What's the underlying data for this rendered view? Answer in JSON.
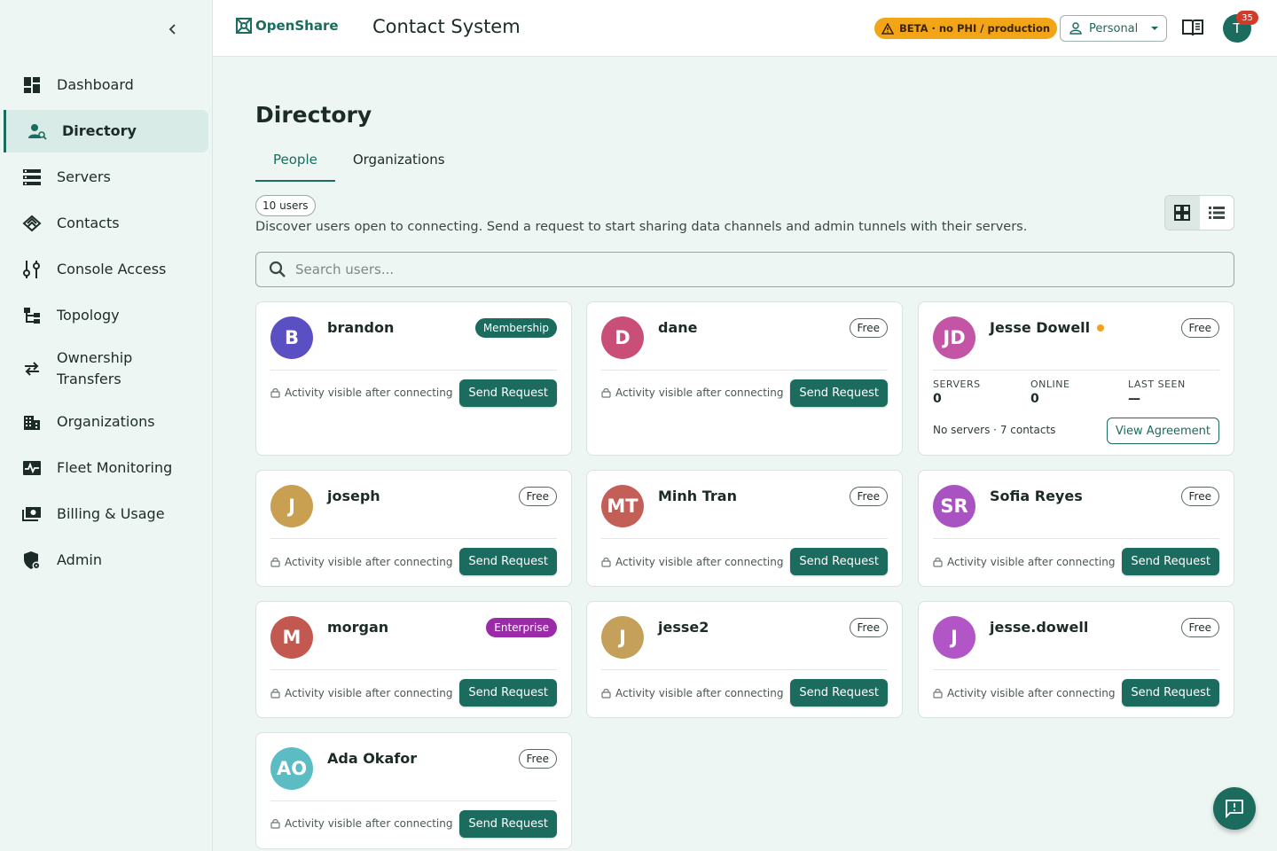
{
  "app": {
    "brand_name": "OpenShare",
    "title": "Contact System",
    "beta_label": "BETA · no PHI / production",
    "account_selector": "Personal",
    "notification_count": "35",
    "user_initial": "T"
  },
  "sidebar": {
    "items": [
      {
        "label": "Dashboard",
        "icon": "dashboard-icon"
      },
      {
        "label": "Directory",
        "icon": "directory-icon",
        "active": true
      },
      {
        "label": "Servers",
        "icon": "servers-icon"
      },
      {
        "label": "Contacts",
        "icon": "contacts-icon"
      },
      {
        "label": "Console Access",
        "icon": "console-access-icon"
      },
      {
        "label": "Topology",
        "icon": "topology-icon"
      },
      {
        "label": "Ownership Transfers",
        "icon": "transfer-icon"
      },
      {
        "label": "Organizations",
        "icon": "organizations-icon"
      },
      {
        "label": "Fleet Monitoring",
        "icon": "fleet-monitoring-icon"
      },
      {
        "label": "Billing & Usage",
        "icon": "billing-icon"
      },
      {
        "label": "Admin",
        "icon": "admin-icon"
      }
    ]
  },
  "main": {
    "title": "Directory",
    "tabs": [
      {
        "label": "People",
        "active": true
      },
      {
        "label": "Organizations",
        "active": false
      }
    ],
    "user_count": "10 users",
    "description": "Discover users open to connecting. Send a request to start sharing data channels and admin tunnels with their servers.",
    "search_placeholder": "Search users...",
    "view_mode": "grid"
  },
  "cards": [
    {
      "initials": "B",
      "name": "brandon",
      "plan": "Membership",
      "avatar_color": "#5b4fc4",
      "hint": "Activity visible after connecting",
      "action": "Send Request"
    },
    {
      "initials": "D",
      "name": "dane",
      "plan": "Free",
      "avatar_color": "#c94f78",
      "hint": "Activity visible after connecting",
      "action": "Send Request"
    },
    {
      "initials": "JD",
      "name": "Jesse Dowell",
      "plan": "Free",
      "avatar_color": "#c455a6",
      "online": true,
      "stats": [
        {
          "label": "SERVERS",
          "value": "0"
        },
        {
          "label": "ONLINE",
          "value": "0"
        },
        {
          "label": "LAST SEEN",
          "value": "—"
        }
      ],
      "summary": "No servers · 7 contacts",
      "action": "View Agreement"
    },
    {
      "initials": "J",
      "name": "joseph",
      "plan": "Free",
      "avatar_color": "#c9a052",
      "hint": "Activity visible after connecting",
      "action": "Send Request"
    },
    {
      "initials": "MT",
      "name": "Minh Tran",
      "plan": "Free",
      "avatar_color": "#c45f58",
      "hint": "Activity visible after connecting",
      "action": "Send Request"
    },
    {
      "initials": "SR",
      "name": "Sofia Reyes",
      "plan": "Free",
      "avatar_color": "#a953c2",
      "hint": "Activity visible after connecting",
      "action": "Send Request"
    },
    {
      "initials": "M",
      "name": "morgan",
      "plan": "Enterprise",
      "avatar_color": "#c2584f",
      "hint": "Activity visible after connecting",
      "action": "Send Request"
    },
    {
      "initials": "J",
      "name": "jesse2",
      "plan": "Free",
      "avatar_color": "#c4a05a",
      "hint": "Activity visible after connecting",
      "action": "Send Request"
    },
    {
      "initials": "J",
      "name": "jesse.dowell",
      "plan": "Free",
      "avatar_color": "#b255c6",
      "hint": "Activity visible after connecting",
      "action": "Send Request"
    },
    {
      "initials": "AO",
      "name": "Ada Okafor",
      "plan": "Free",
      "avatar_color": "#5bbcc4",
      "hint": "Activity visible after connecting",
      "action": "Send Request"
    }
  ],
  "colors": {
    "primary": "#1b6b5f",
    "beta": "#f2a516",
    "enterprise": "#9b2aa8",
    "notification": "#d43a2a"
  }
}
